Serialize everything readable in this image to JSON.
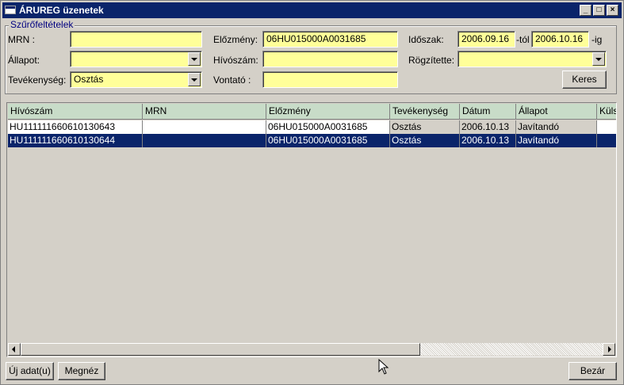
{
  "window": {
    "title": "ÁRUREG üzenetek",
    "min_glyph": "_",
    "max_glyph": "□",
    "close_glyph": "×"
  },
  "filters": {
    "legend": "Szűrőfeltételek",
    "mrn_label": "MRN :",
    "mrn_value": "",
    "allapot_label": "Állapot:",
    "allapot_value": "",
    "tevekenyseg_label": "Tevékenység:",
    "tevekenyseg_value": "Osztás",
    "elozmeny_label": "Előzmény:",
    "elozmeny_value": "06HU015000A0031685",
    "hivoszam_label": "Hívószám:",
    "hivoszam_value": "",
    "vontato_label": "Vontató :",
    "vontato_value": "",
    "idoszak_label": "Időszak:",
    "idoszak_from": "2006.09.16",
    "tol_label": "-tól",
    "idoszak_to": "2006.10.16",
    "ig_label": "-ig",
    "rogzitette_label": "Rögzítette:",
    "rogzitette_value": "",
    "search_button": "Keres"
  },
  "table": {
    "columns": [
      "Hívószám",
      "MRN",
      "Előzmény",
      "Tevékenység",
      "Dátum",
      "Állapot",
      "Küls"
    ],
    "rows": [
      [
        "HU111111660610130643",
        "",
        "06HU015000A0031685",
        "Osztás",
        "2006.10.13",
        "Javítandó",
        ""
      ],
      [
        "HU111111660610130644",
        "",
        "06HU015000A0031685",
        "Osztás",
        "2006.10.13",
        "Javítandó",
        ""
      ]
    ],
    "selected_row": 1
  },
  "footer": {
    "new_button": "Új adat(u)",
    "view_button": "Megnéz",
    "close_button": "Bezár"
  },
  "icons": {
    "app": "window-icon",
    "scroll_left": "arrow-left-icon",
    "scroll_right": "arrow-right-icon",
    "combo": "chevron-down-icon"
  },
  "colors": {
    "titlebar": "#0a246a",
    "field_bg": "#ffff99",
    "header_bg": "#c8dcc8",
    "selected_row": "#0a246a",
    "legend": "#000080"
  }
}
